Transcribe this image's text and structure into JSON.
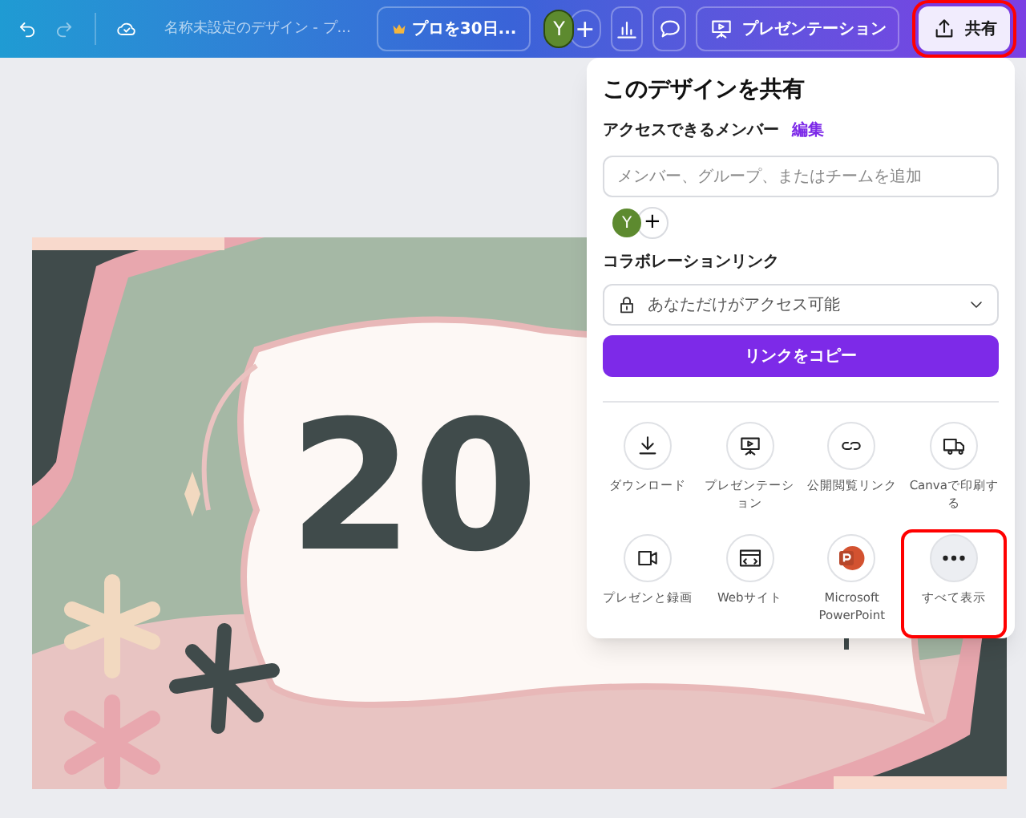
{
  "top_bar": {
    "document_title": "名称未設定のデザイン - プ...",
    "pro_button": "プロを30日...",
    "avatar": "Y",
    "plus": "+",
    "present_button": "プレゼンテーション",
    "share_button": {
      "label": "共有",
      "highlighted": true
    }
  },
  "design": {
    "year": "20"
  },
  "share_panel": {
    "title": "このデザインを共有",
    "members_label": "アクセスできるメンバー",
    "edit_link": "編集",
    "member_field": {
      "placeholder": "メンバー、グループ、またはチームを追加"
    },
    "avatar": "Y",
    "plus": "+",
    "collab_label": "コラボレーションリンク",
    "access_select": "あなただけがアクセス可能",
    "copy_button": "リンクをコピー",
    "options": [
      {
        "kind": "download",
        "label": "ダウンロード",
        "highlighted": false
      },
      {
        "kind": "present",
        "label": "プレゼンテーション",
        "highlighted": false
      },
      {
        "kind": "link",
        "label": "公開閲覧リンク",
        "highlighted": false
      },
      {
        "kind": "print",
        "label": "Canvaで印刷する",
        "highlighted": false
      },
      {
        "kind": "record",
        "label": "プレゼンと録画",
        "highlighted": false
      },
      {
        "kind": "website",
        "label": "Webサイト",
        "highlighted": false
      },
      {
        "kind": "powerpoint",
        "label": "Microsoft PowerPoint",
        "highlighted": false
      },
      {
        "kind": "more",
        "label": "すべて表示",
        "highlighted": true
      }
    ]
  }
}
